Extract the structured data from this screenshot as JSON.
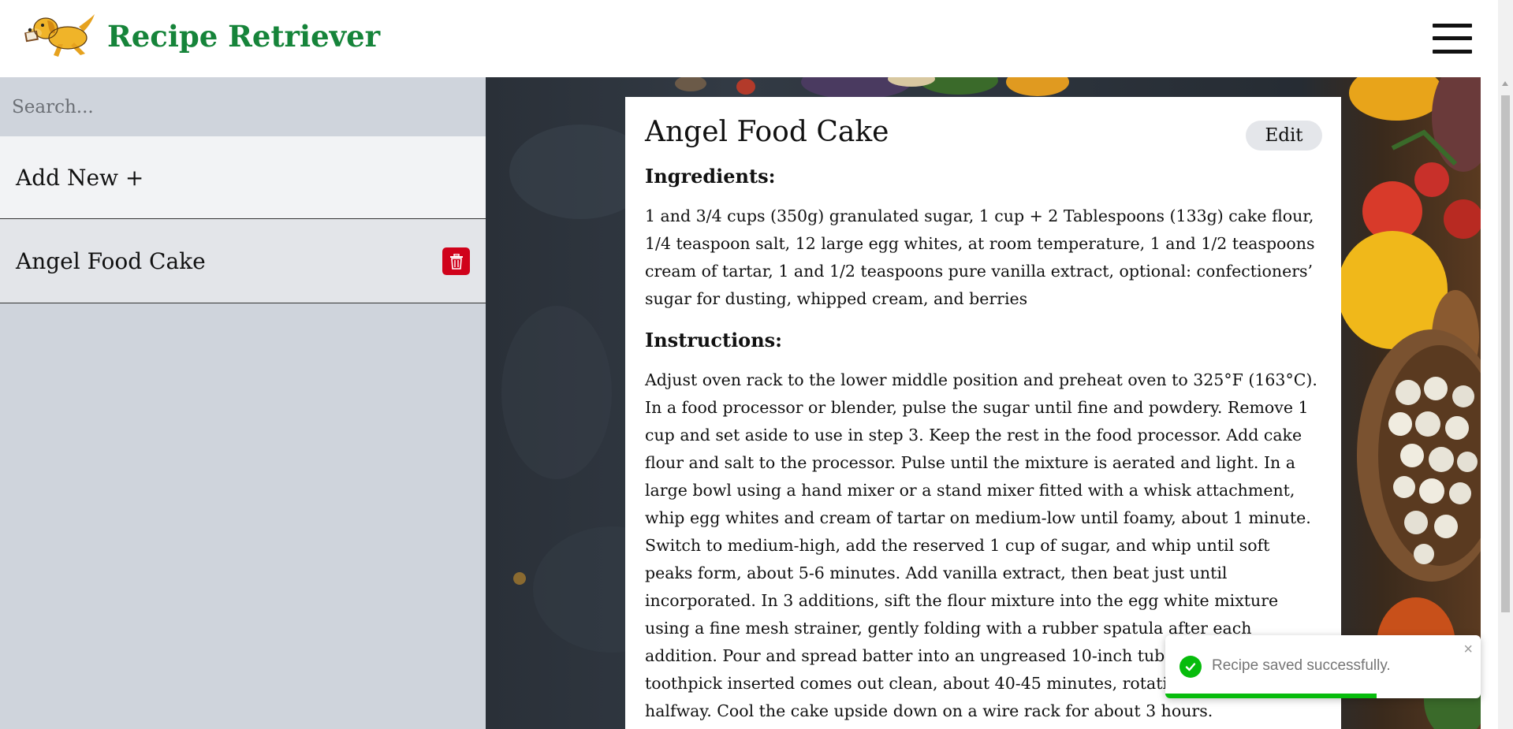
{
  "header": {
    "app_title": "Recipe Retriever",
    "logo_icon": "golden-retriever-dog-logo",
    "menu_icon": "hamburger-icon"
  },
  "sidebar": {
    "search_placeholder": "Search...",
    "add_new_label": "Add New +",
    "recipes": [
      {
        "name": "Angel Food Cake",
        "delete_icon": "trash-icon"
      }
    ]
  },
  "recipe": {
    "title": "Angel Food Cake",
    "edit_label": "Edit",
    "ingredients_heading": "Ingredients:",
    "ingredients": "1 and 3/4 cups (350g) granulated sugar, 1 cup + 2 Tablespoons (133g) cake flour, 1/4 teaspoon salt, 12 large egg whites, at room temperature, 1 and 1/2 teaspoons cream of tartar, 1 and 1/2 teaspoons pure vanilla extract, optional: confectioners’ sugar for dusting, whipped cream, and berries",
    "instructions_heading": "Instructions:",
    "instructions": "Adjust oven rack to the lower middle position and preheat oven to 325°F (163°C). In a food processor or blender, pulse the sugar until fine and powdery. Remove 1 cup and set aside to use in step 3. Keep the rest in the food processor. Add cake flour and salt to the processor. Pulse until the mixture is aerated and light. In a large bowl using a hand mixer or a stand mixer fitted with a whisk attachment, whip egg whites and cream of tartar on medium-low until foamy, about 1 minute. Switch to medium-high, add the reserved 1 cup of sugar, and whip until soft peaks form, about 5-6 minutes. Add vanilla extract, then beat just until incorporated. In 3 additions, sift the flour mixture into the egg white mixture using a fine mesh strainer, gently folding with a rubber spatula after each addition. Pour and spread batter into an ungreased 10-inch tube pan. Bake until a toothpick inserted comes out clean, about 40-45 minutes, rotating the pan halfway. Cool the cake upside down on a wire rack for about 3 hours."
  },
  "toast": {
    "message": "Recipe saved successfully.",
    "close_glyph": "×",
    "status_icon": "check-circle-icon",
    "progress": 0.67,
    "color": "#07bc0c"
  },
  "colors": {
    "brand": "#16843a",
    "delete": "#d0021b",
    "sidebar_bg": "#cfd4dc"
  }
}
